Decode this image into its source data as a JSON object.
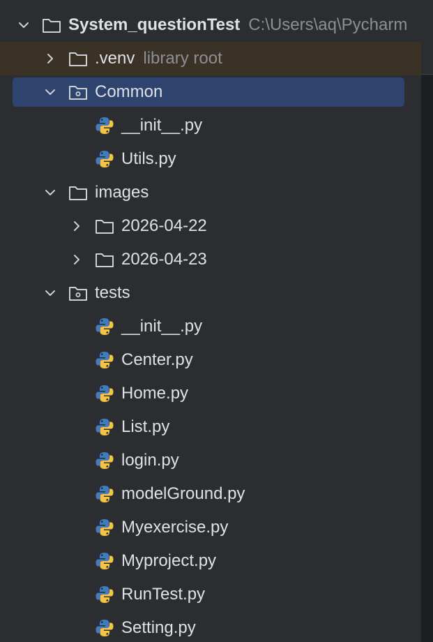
{
  "project": {
    "name": "System_questionTest",
    "path": "C:\\Users\\aq\\Pycharm"
  },
  "tree": {
    "venv": {
      "name": ".venv",
      "hint": "library root"
    },
    "common": {
      "name": "Common",
      "files": [
        "__init__.py",
        "Utils.py"
      ]
    },
    "images": {
      "name": "images",
      "folders": [
        "2026-04-22",
        "2026-04-23"
      ]
    },
    "tests": {
      "name": "tests",
      "files": [
        "__init__.py",
        "Center.py",
        "Home.py",
        "List.py",
        "login.py",
        "modelGround.py",
        "Myexercise.py",
        "Myproject.py",
        "RunTest.py",
        "Setting.py"
      ]
    }
  },
  "colors": {
    "background": "#2b2d30",
    "selection": "#2e436e",
    "venv_highlight": "#3a3227",
    "text": "#dfe1e5",
    "hint": "#8c8f94",
    "python_blue": "#3f7cc4",
    "python_yellow": "#f5c542"
  },
  "icons": {
    "chevron_expanded": "chevron-down-icon",
    "chevron_collapsed": "chevron-right-icon",
    "folder": "folder-icon",
    "package": "package-folder-icon",
    "python_file": "python-file-icon"
  }
}
